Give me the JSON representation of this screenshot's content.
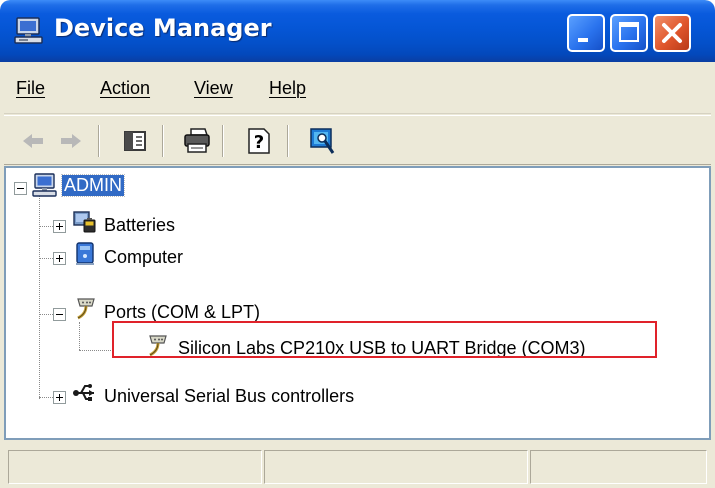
{
  "window": {
    "title": "Device Manager",
    "icon": "computer-icon",
    "controls": [
      "minimize-icon",
      "maximize-icon",
      "close-icon"
    ]
  },
  "menu": {
    "items": [
      {
        "label": "File"
      },
      {
        "label": "Action"
      },
      {
        "label": "View"
      },
      {
        "label": "Help"
      }
    ]
  },
  "toolbar": {
    "buttons": [
      "back-icon",
      "forward-icon",
      "show-hide-console-tree-icon",
      "print-icon",
      "help-icon",
      "scan-hardware-icon"
    ]
  },
  "tree": {
    "root": {
      "label": "ADMIN",
      "icon": "computer-icon",
      "selected": true
    },
    "nodes": [
      {
        "label": "Batteries",
        "icon": "battery-icon",
        "expanded": false
      },
      {
        "label": "Computer",
        "icon": "computer-icon",
        "expanded": false
      },
      {
        "label": "Ports (COM & LPT)",
        "icon": "port-icon",
        "expanded": true,
        "children": [
          {
            "label": "Silicon Labs CP210x USB to UART Bridge (COM3)",
            "icon": "port-icon"
          }
        ]
      },
      {
        "label": "Universal Serial Bus controllers",
        "icon": "usb-icon",
        "expanded": false
      }
    ]
  },
  "colors": {
    "titlebar": "#0556d6",
    "selection": "#316ac5",
    "highlight_box": "#e0222a",
    "close_button": "#e0562c"
  }
}
